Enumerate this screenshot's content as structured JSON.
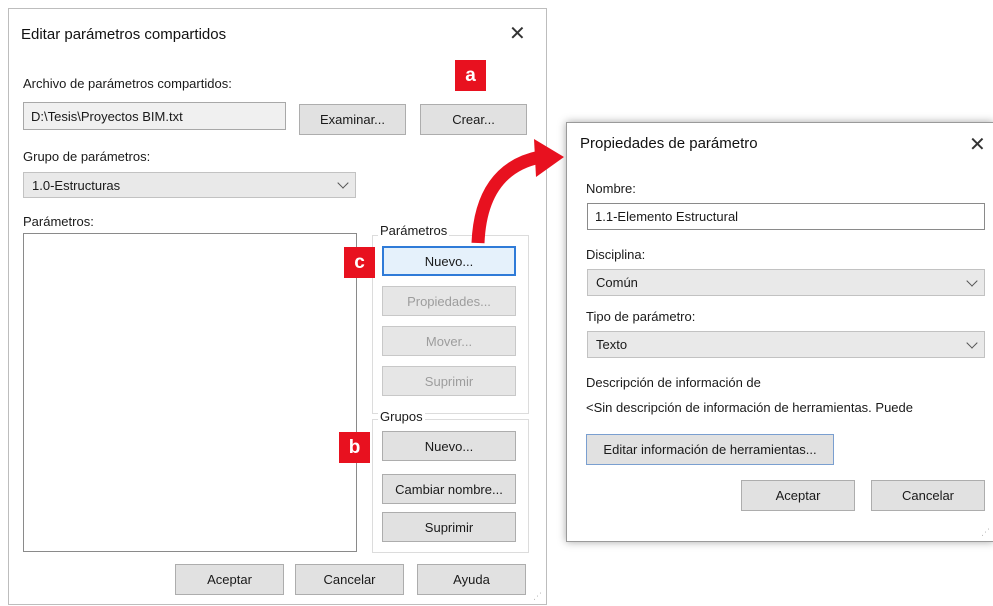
{
  "main_dialog": {
    "title": "Editar parámetros compartidos",
    "close_glyph": "✕",
    "file_label": "Archivo de parámetros compartidos:",
    "file_value": "D:\\Tesis\\Proyectos BIM.txt",
    "browse_label": "Examinar...",
    "create_label": "Crear...",
    "group_label": "Grupo de parámetros:",
    "group_value": "1.0-Estructuras",
    "params_label": "Parámetros:",
    "params_group_title": "Parámetros",
    "param_new_label": "Nuevo...",
    "param_props_label": "Propiedades...",
    "param_move_label": "Mover...",
    "param_delete_label": "Suprimir",
    "groups_group_title": "Grupos",
    "group_new_label": "Nuevo...",
    "group_rename_label": "Cambiar nombre...",
    "group_delete_label": "Suprimir",
    "ok_label": "Aceptar",
    "cancel_label": "Cancelar",
    "help_label": "Ayuda"
  },
  "property_dialog": {
    "title": "Propiedades de parámetro",
    "close_glyph": "✕",
    "name_label": "Nombre:",
    "name_value": "1.1-Elemento Estructural",
    "discipline_label": "Disciplina:",
    "discipline_value": "Común",
    "type_label": "Tipo de parámetro:",
    "type_value": "Texto",
    "desc_label": "Descripción de información de",
    "desc_value": "<Sin descripción de información de herramientas. Puede",
    "edit_tooltip_label": "Editar información de herramientas...",
    "ok_label": "Aceptar",
    "cancel_label": "Cancelar"
  },
  "annotations": {
    "badge_a": "a",
    "badge_b": "b",
    "badge_c": "c",
    "badge_color": "#e8111f",
    "arrow_color": "#e8111f"
  }
}
